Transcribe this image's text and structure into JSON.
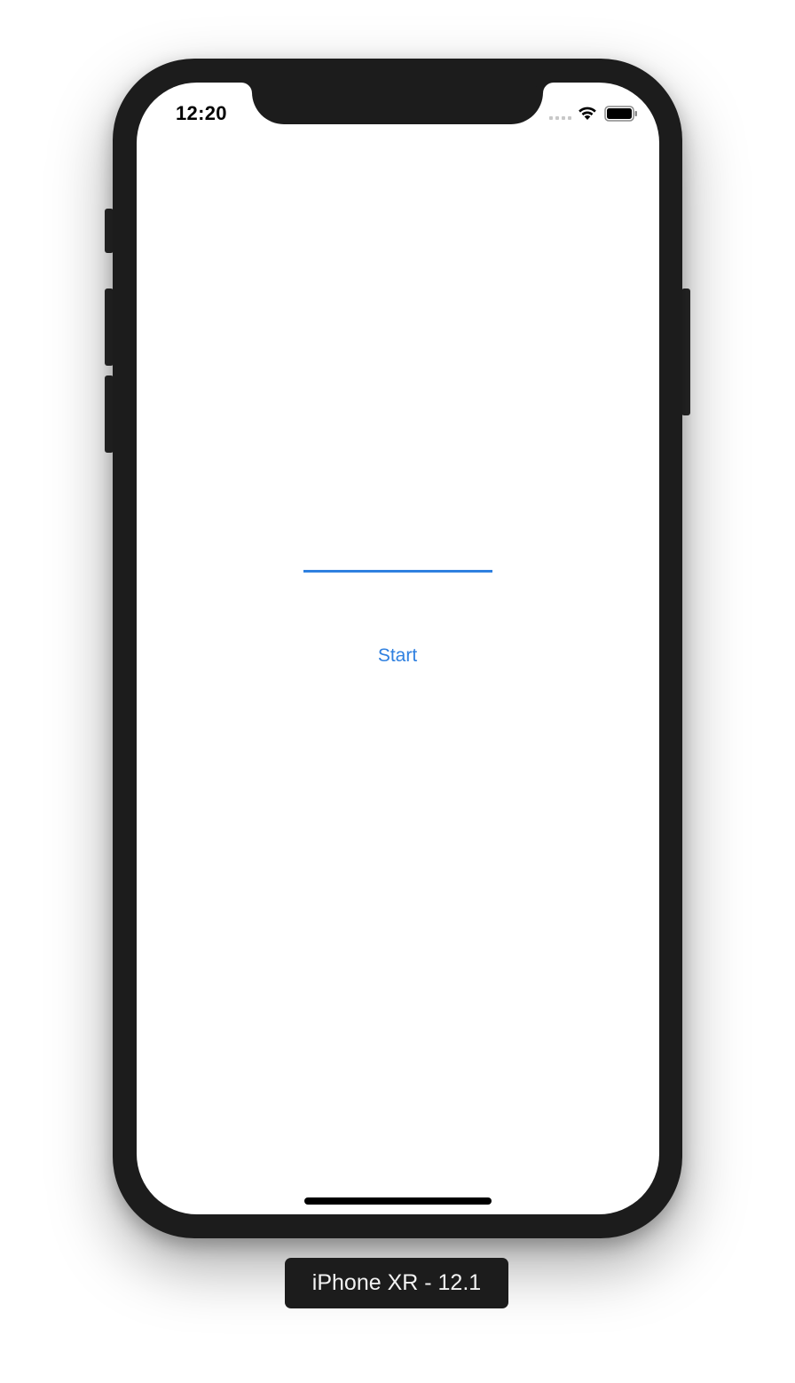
{
  "status_bar": {
    "time": "12:20",
    "signal_icon": "cellular-signal-icon",
    "wifi_icon": "wifi-icon",
    "battery_icon": "battery-icon"
  },
  "main": {
    "text_field": {
      "value": "",
      "placeholder": ""
    },
    "start_label": "Start"
  },
  "simulator": {
    "device_label": "iPhone XR - 12.1"
  },
  "colors": {
    "accent": "#2f80e0",
    "bezel": "#1c1c1c",
    "screen": "#ffffff"
  }
}
